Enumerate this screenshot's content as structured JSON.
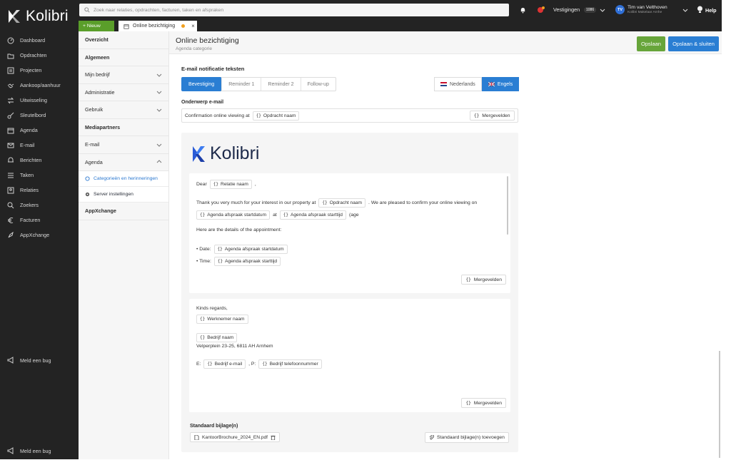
{
  "app": {
    "name": "Kolibri"
  },
  "nav": {
    "items": [
      {
        "label": "Dashboard",
        "icon": "dashboard-icon"
      },
      {
        "label": "Opdrachten",
        "icon": "folder-icon"
      },
      {
        "label": "Projecten",
        "icon": "projects-icon"
      },
      {
        "label": "Aankoop/aanhuur",
        "icon": "handshake-icon"
      },
      {
        "label": "Uitwisseling",
        "icon": "exchange-icon"
      },
      {
        "label": "Sleutelbord",
        "icon": "key-icon"
      },
      {
        "label": "Agenda",
        "icon": "calendar-icon"
      },
      {
        "label": "E-mail",
        "icon": "mail-icon"
      },
      {
        "label": "Berichten",
        "icon": "bell-icon"
      },
      {
        "label": "Taken",
        "icon": "list-icon"
      },
      {
        "label": "Relaties",
        "icon": "contacts-icon"
      },
      {
        "label": "Zoekers",
        "icon": "search-icon"
      },
      {
        "label": "Facturen",
        "icon": "euro-icon"
      },
      {
        "label": "AppXchange",
        "icon": "rocket-icon"
      }
    ],
    "bug_label": "Meld een bug"
  },
  "topbar": {
    "search_placeholder": "Zoek naar relaties, opdrachten, facturen, taken en afspraken",
    "vestigingen_label": "Vestigingen",
    "vestigingen_badge": "1086",
    "user_initials": "TV",
    "user_name": "Tim van Velthoven",
    "user_sub": "Kolibri Makelaar Arnhe",
    "help_label": "Help"
  },
  "tabstrip": {
    "new_label": "+ Nieuw",
    "doc_tab_label": "Online bezichtiging"
  },
  "subnav": {
    "overzicht": "Overzicht",
    "algemeen": "Algemeen",
    "mijn_bedrijf": "Mijn bedrijf",
    "administratie": "Administratie",
    "gebruik": "Gebruik",
    "mediapartners": "Mediapartners",
    "email": "E-mail",
    "agenda": "Agenda",
    "categorieen": "Categorieën en herinneringen",
    "server": "Server instellingen",
    "appxchange": "AppXchange"
  },
  "page": {
    "title": "Online bezichtiging",
    "subtitle": "Agenda categorie",
    "save_label": "Opslaan",
    "save_close_label": "Opslaan & sluiten"
  },
  "section": {
    "title": "E-mail notificatie teksten",
    "tabs": [
      "Bevestiging",
      "Reminder 1",
      "Reminder 2",
      "Follow-up"
    ],
    "active_tab": "Bevestiging",
    "lang_nl": "Nederlands",
    "lang_en": "Engels"
  },
  "subject": {
    "label": "Onderwerp e-mail",
    "prefix": "Confirmation online viewing at",
    "chip": "Opdracht naam",
    "merge_label": "Mergevelden"
  },
  "body": {
    "dear": "Dear",
    "chip_relatie": "Relatie naam",
    "comma": ",",
    "thanks": "Thank you very much for your interest in our property at",
    "chip_opdracht": "Opdracht naam",
    "pleased": ". We are pleased to confirm your online viewing on",
    "chip_startdatum": "Agenda afspraak startdatum",
    "at": "at",
    "chip_starttijd": "Agenda afspraak starttijd",
    "take": "(age",
    "details": "Here are the details of the appointment:",
    "date_label": "• Date:",
    "time_label": "• Time:",
    "merge_label": "Mergevelden"
  },
  "signature": {
    "regards": "Kinds regards,",
    "chip_werknemer": "Werknemer naam",
    "chip_bedrijf": "Bedrijf naam",
    "address": "Velperplein 23-25, 6811 AH Arnhem",
    "e_label": "E:",
    "chip_email": "Bedrijf e-mail",
    "p_label": ", P:",
    "chip_tel": "Bedrijf telefoonnummer",
    "merge_label": "Mergevelden"
  },
  "attachments": {
    "label": "Standaard bijlage(n)",
    "file": "KantoorBrochure_2024_EN.pdf",
    "add_label": "Standaard bijlage(n) toevoegen"
  },
  "colors": {
    "sidebar": "#232323",
    "primary": "#2a7ed3",
    "success": "#67a53a",
    "new_button": "#5a9e2a"
  }
}
